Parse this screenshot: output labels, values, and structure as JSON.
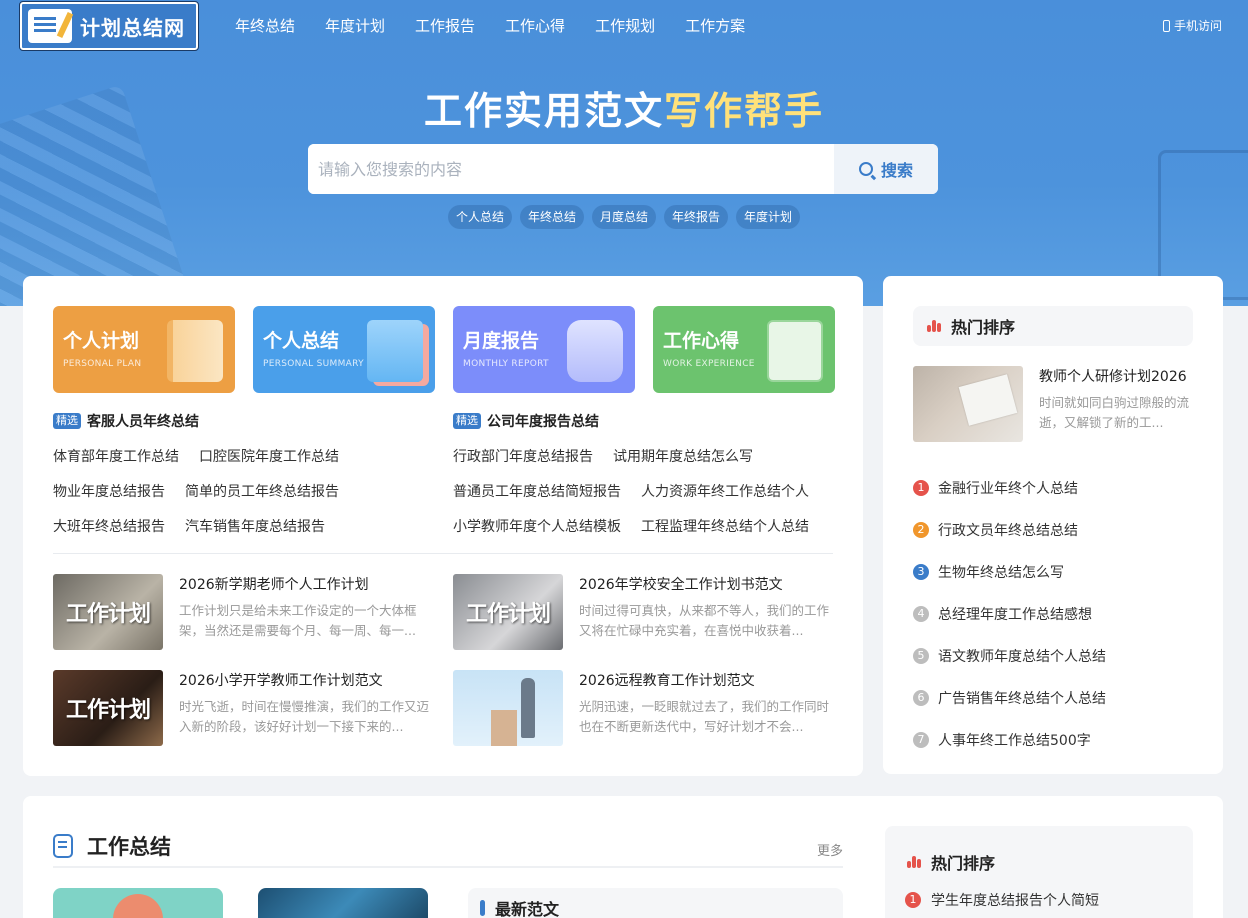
{
  "header": {
    "logo_text": "计划总结网",
    "nav": [
      "年终总结",
      "年度计划",
      "工作报告",
      "工作心得",
      "工作规划",
      "工作方案"
    ],
    "mobile_label": "手机访问"
  },
  "hero": {
    "slogan_main": "工作实用范文",
    "slogan_highlight": "写作帮手",
    "search_placeholder": "请输入您搜索的内容",
    "search_button": "搜索",
    "tags": [
      "个人总结",
      "年终总结",
      "月度总结",
      "年终报告",
      "年度计划"
    ]
  },
  "categories": [
    {
      "title": "个人计划",
      "subtitle": "PERSONAL PLAN"
    },
    {
      "title": "个人总结",
      "subtitle": "PERSONAL SUMMARY"
    },
    {
      "title": "月度报告",
      "subtitle": "MONTHLY REPORT"
    },
    {
      "title": "工作心得",
      "subtitle": "WORK EXPERIENCE"
    }
  ],
  "picks": {
    "badge": "精选",
    "left": {
      "title": "客服人员年终总结",
      "rows": [
        [
          "体育部年度工作总结",
          "口腔医院年度工作总结"
        ],
        [
          "物业年度总结报告",
          "简单的员工年终总结报告"
        ],
        [
          "大班年终总结报告",
          "汽车销售年度总结报告"
        ]
      ]
    },
    "right": {
      "title": "公司年度报告总结",
      "rows": [
        [
          "行政部门年度总结报告",
          "试用期年度总结怎么写"
        ],
        [
          "普通员工年度总结简短报告",
          "人力资源年终工作总结个人"
        ],
        [
          "小学教师年度个人总结模板",
          "工程监理年终总结个人总结"
        ]
      ]
    }
  },
  "articles": [
    {
      "thumb": "工作计划",
      "title": "2026新学期老师个人工作计划",
      "desc": "工作计划只是给未来工作设定的一个大体框架，当然还是需要每个月、每一周、每一..."
    },
    {
      "thumb": "工作计划",
      "title": "2026年学校安全工作计划书范文",
      "desc": "时间过得可真快，从来都不等人，我们的工作又将在忙碌中充实着，在喜悦中收获着..."
    },
    {
      "thumb": "工作计划",
      "title": "2026小学开学教师工作计划范文",
      "desc": "时光飞逝，时间在慢慢推演，我们的工作又迈入新的阶段，该好好计划一下接下来的..."
    },
    {
      "thumb": "",
      "title": "2026远程教育工作计划范文",
      "desc": "光阴迅速，一眨眼就过去了，我们的工作同时也在不断更新迭代中，写好计划才不会..."
    }
  ],
  "sidebar": {
    "title": "热门排序",
    "featured": {
      "title": "教师个人研修计划2026",
      "desc": "时间就如同白驹过隙般的流逝，又解锁了新的工..."
    },
    "ranking": [
      {
        "num": "1",
        "text": "金融行业年终个人总结",
        "color": "#e5534b"
      },
      {
        "num": "2",
        "text": "行政文员年终总结总结",
        "color": "#f0962c"
      },
      {
        "num": "3",
        "text": "生物年终总结怎么写",
        "color": "#3a7cc9"
      },
      {
        "num": "4",
        "text": "总经理年度工作总结感想",
        "color": "#bdbdbd"
      },
      {
        "num": "5",
        "text": "语文教师年度总结个人总结",
        "color": "#bdbdbd"
      },
      {
        "num": "6",
        "text": "广告销售年终总结个人总结",
        "color": "#bdbdbd"
      },
      {
        "num": "7",
        "text": "人事年终工作总结500字",
        "color": "#bdbdbd"
      }
    ]
  },
  "lower": {
    "section_title": "工作总结",
    "more": "更多",
    "newest_title": "最新范文",
    "side_title": "热门排序",
    "side_first": {
      "num": "1",
      "text": "学生年度总结报告个人简短"
    }
  },
  "colors": {
    "brand": "#3a7cc9",
    "hero_bg": "#4d93dc",
    "highlight": "#ffe17a"
  }
}
